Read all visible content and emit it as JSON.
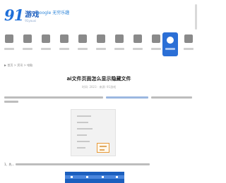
{
  "header": {
    "logo_number": "91",
    "logo_name": "游戏",
    "logo_sub": "91youxi",
    "slogan": "google 无穷乐趣"
  },
  "nav": {
    "items": [
      {
        "icon": "home-icon",
        "color": "#8a8a8a"
      },
      {
        "icon": "gamepad-icon",
        "color": "#8a8a8a"
      },
      {
        "icon": "grid-icon",
        "color": "#8a8a8a"
      },
      {
        "icon": "puzzle-icon",
        "color": "#8a8a8a"
      },
      {
        "icon": "apple-icon",
        "color": "#8a8a8a"
      },
      {
        "icon": "android-icon",
        "color": "#8a8a8a"
      },
      {
        "icon": "calendar-icon",
        "color": "#8a8a8a"
      },
      {
        "icon": "news-icon",
        "color": "#8a8a8a"
      },
      {
        "icon": "user-icon",
        "color": "#8a8a8a"
      },
      {
        "icon": "bulb-icon",
        "color": "#ffffff",
        "active": true
      },
      {
        "icon": "more-icon",
        "color": "#8a8a8a"
      }
    ]
  },
  "article": {
    "breadcrumb": "▶ 首页 > 资讯 > 电脑",
    "title": "ai文件页面怎么显示隐藏文件",
    "meta": "时间: 2023 · 来源: 91游戏",
    "caption": "1、先..."
  },
  "colors": {
    "brand": "#1e6fd9",
    "active_nav": "#2b6fd6",
    "highlight": "#e89a3a"
  }
}
